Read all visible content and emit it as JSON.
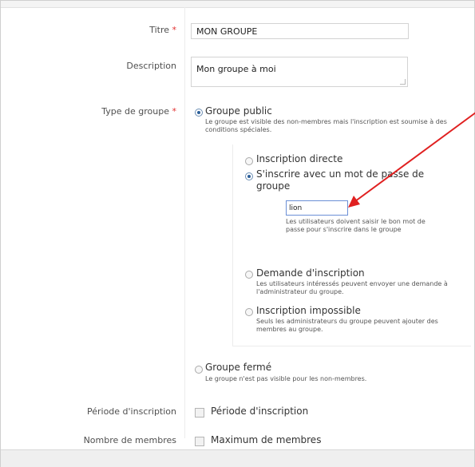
{
  "form": {
    "title_label": "Titre",
    "required_mark": "*",
    "title_value": "MON GROUPE",
    "description_label": "Description",
    "description_value": "Mon groupe à moi",
    "type_label": "Type de groupe",
    "public": {
      "label": "Groupe public",
      "desc": "Le groupe est visible des non-membres mais l'inscription est soumise à des conditions spéciales.",
      "selected": true
    },
    "sub_options": {
      "direct": {
        "label": "Inscription directe"
      },
      "password": {
        "label": "S'inscrire avec un mot de passe de groupe",
        "selected": true,
        "input_value": "lion",
        "help": "Les utilisateurs doivent saisir le bon mot de passe pour s'inscrire dans le groupe"
      },
      "request": {
        "label": "Demande d'inscription",
        "desc": "Les utilisateurs intéressés peuvent envoyer une demande à l'administrateur du groupe."
      },
      "impossible": {
        "label": "Inscription impossible",
        "desc": "Seuls les administrateurs du groupe peuvent ajouter des membres au groupe."
      }
    },
    "closed": {
      "label": "Groupe fermé",
      "desc": "Le groupe n'est pas visible pour les non-membres."
    },
    "period_label": "Période d'inscription",
    "period_checkbox": "Période d'inscription",
    "members_label": "Nombre de membres",
    "members_checkbox": "Maximum de membres"
  },
  "colors": {
    "required": "#e23030",
    "arrow": "#e02020",
    "radio_selected": "#2c5f99"
  }
}
